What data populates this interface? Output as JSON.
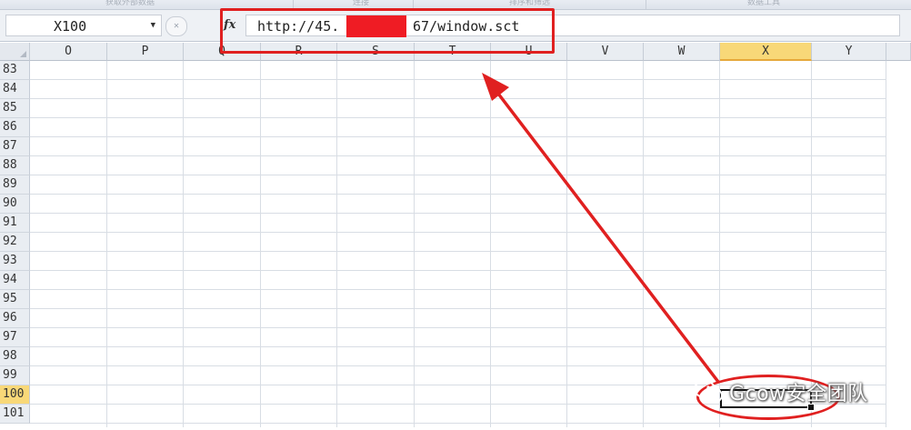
{
  "ribbon": {
    "groups": [
      {
        "label": "获取外部数据"
      },
      {
        "label": "连接"
      },
      {
        "label": "排序和筛选"
      },
      {
        "label": "数据工具"
      }
    ]
  },
  "formula_bar": {
    "name_box": "X100",
    "fx_label": "fx",
    "formula_visible_start": "http://45.",
    "formula_visible_end": "67/window.sct",
    "cancel_glyph": "✕"
  },
  "sheet": {
    "columns": [
      "O",
      "P",
      "Q",
      "R",
      "S",
      "T",
      "U",
      "V",
      "W",
      "X",
      "Y"
    ],
    "selected_column": "X",
    "rows": [
      "83",
      "84",
      "85",
      "86",
      "87",
      "88",
      "89",
      "90",
      "91",
      "92",
      "93",
      "94",
      "95",
      "96",
      "97",
      "98",
      "99",
      "100",
      "101"
    ],
    "selected_row": "100",
    "active_cell": "X100"
  },
  "annotation": {
    "color": "#e02020"
  },
  "watermark": {
    "text": "Gcow安全团队"
  }
}
